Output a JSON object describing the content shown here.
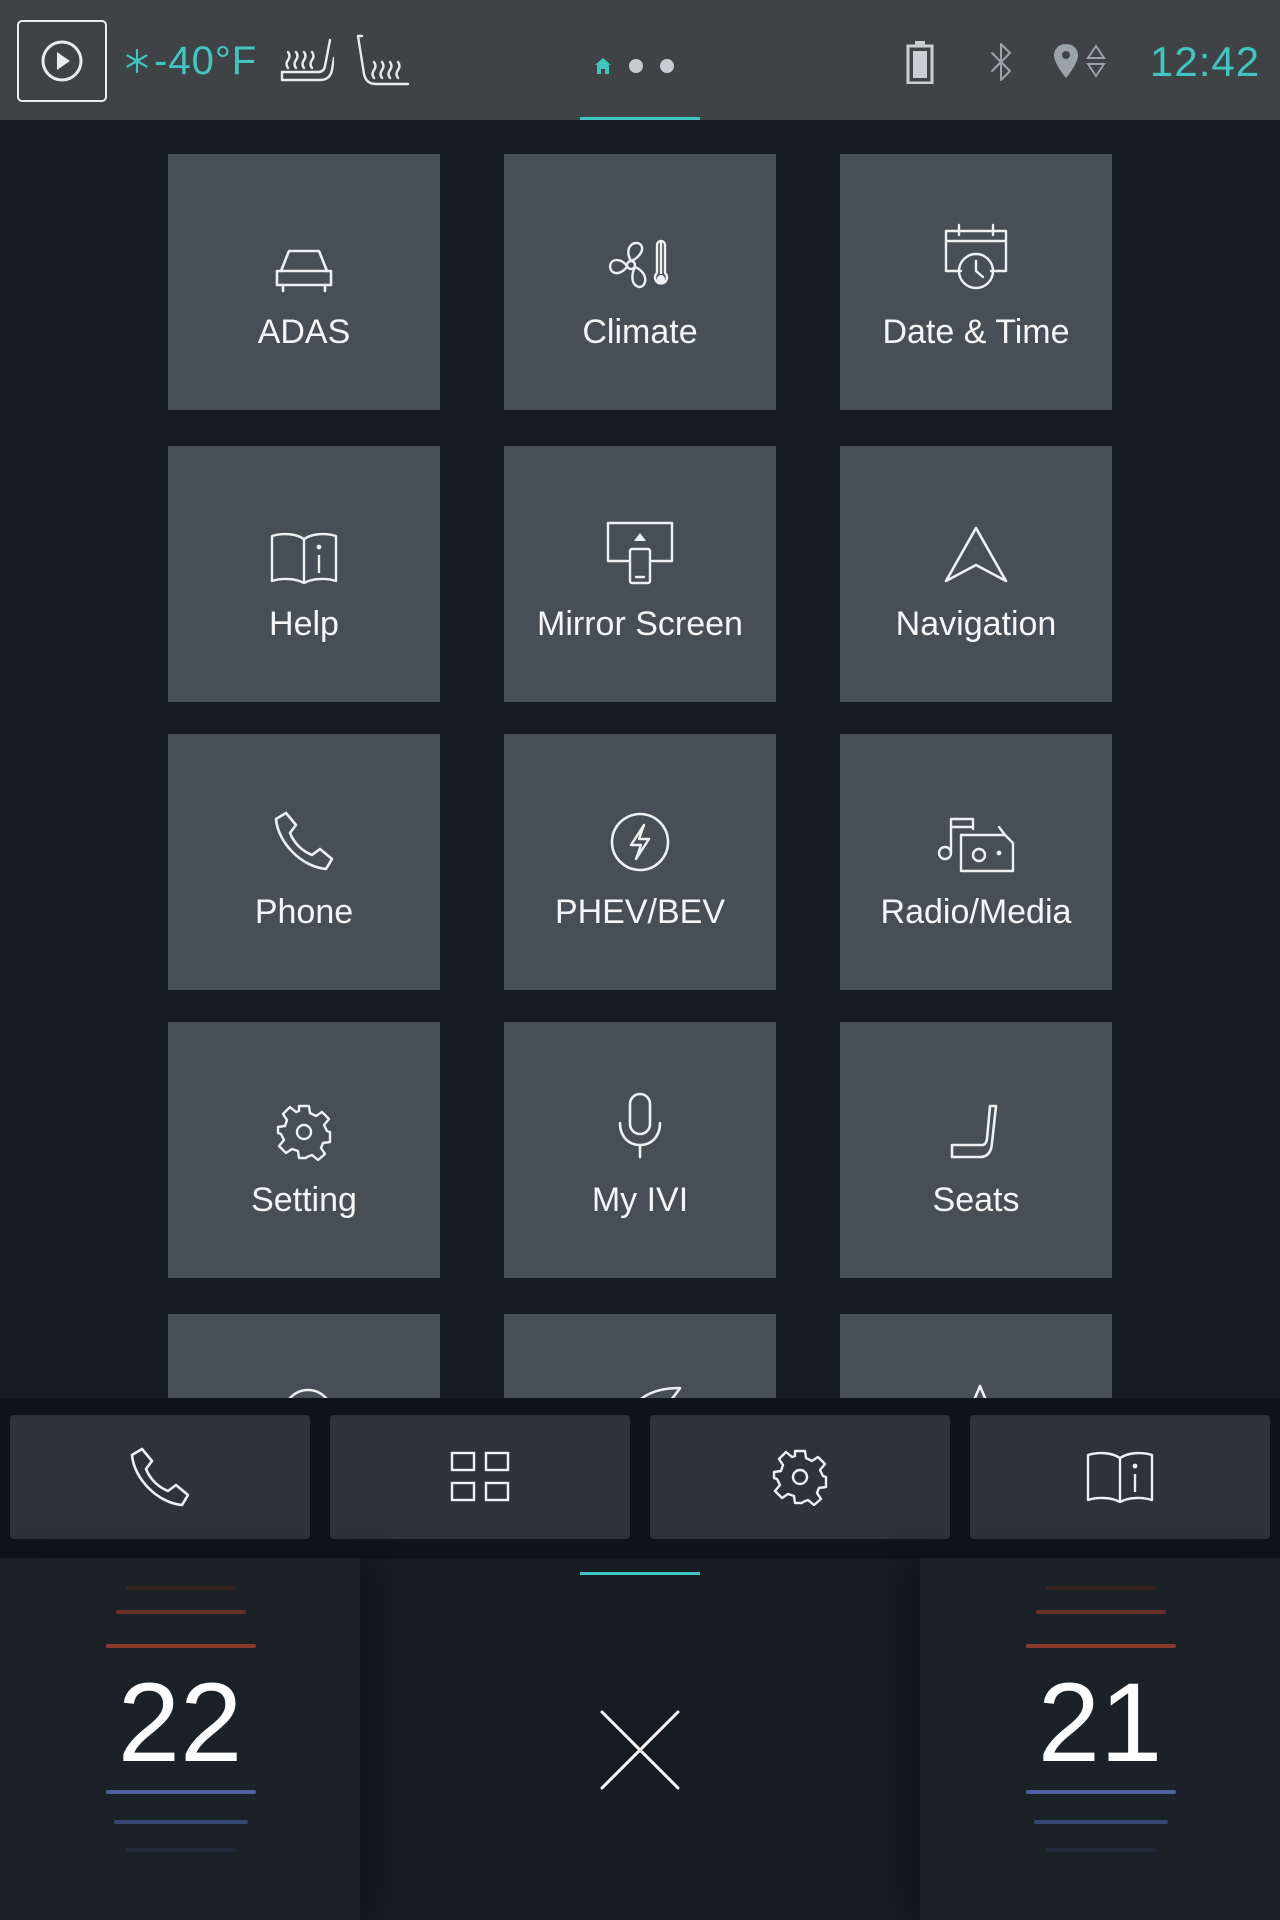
{
  "status_bar": {
    "outside_temp": "-40°F",
    "time": "12:42",
    "icons": [
      "media-play-icon",
      "snowflake-icon",
      "seat-heater-icon",
      "seat-ventilation-icon",
      "home-icon",
      "battery-icon",
      "bluetooth-icon",
      "gps-icon"
    ],
    "accent_color": "#3fc6c0"
  },
  "tiles": [
    {
      "label": "ADAS",
      "icon": "car-icon"
    },
    {
      "label": "Climate",
      "icon": "fan-thermometer-icon"
    },
    {
      "label": "Date & Time",
      "icon": "calendar-clock-icon"
    },
    {
      "label": "Help",
      "icon": "manual-info-icon"
    },
    {
      "label": "Mirror Screen",
      "icon": "mirror-screen-icon"
    },
    {
      "label": "Navigation",
      "icon": "navigation-arrow-icon"
    },
    {
      "label": "Phone",
      "icon": "phone-icon"
    },
    {
      "label": "PHEV/BEV",
      "icon": "lightning-icon"
    },
    {
      "label": "Radio/Media",
      "icon": "radio-music-icon"
    },
    {
      "label": "Setting",
      "icon": "gear-icon"
    },
    {
      "label": "My IVI",
      "icon": "microphone-icon"
    },
    {
      "label": "Seats",
      "icon": "seat-icon"
    }
  ],
  "dock": {
    "icons": [
      "phone-icon",
      "apps-grid-icon",
      "gear-icon",
      "manual-info-icon"
    ]
  },
  "climate": {
    "left_temp": "22",
    "right_temp": "21",
    "heat_color": "#8a3a2c",
    "cool_color": "#4c62a3"
  }
}
